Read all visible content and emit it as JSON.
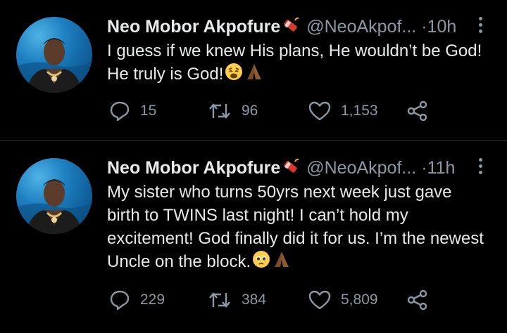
{
  "tweets": [
    {
      "name": "Neo Mobor Akpofure",
      "handle": "@NeoAkpof...",
      "dot": "·",
      "time": "10h",
      "text": "I guess if we knew His plans, He wouldn’t be God! He truly is God!",
      "reply_count": "15",
      "retweet_count": "96",
      "like_count": "1,153"
    },
    {
      "name": "Neo Mobor Akpofure",
      "handle": "@NeoAkpof...",
      "dot": "·",
      "time": "11h",
      "text": "My sister who turns 50yrs next week just gave birth to TWINS last night! I can’t hold my excitement! God finally did it for us. I’m the newest Uncle on the block.",
      "reply_count": "229",
      "retweet_count": "384",
      "like_count": "5,809"
    }
  ],
  "icons": {
    "name_badge": "firecracker-icon",
    "reply": "reply-icon",
    "retweet": "retweet-icon",
    "like": "heart-icon",
    "share": "share-icon",
    "more": "more-options-icon"
  },
  "colors": {
    "background": "#000000",
    "text": "#e7e9ea",
    "secondary": "#8b98a5",
    "divider": "#2f3336"
  }
}
